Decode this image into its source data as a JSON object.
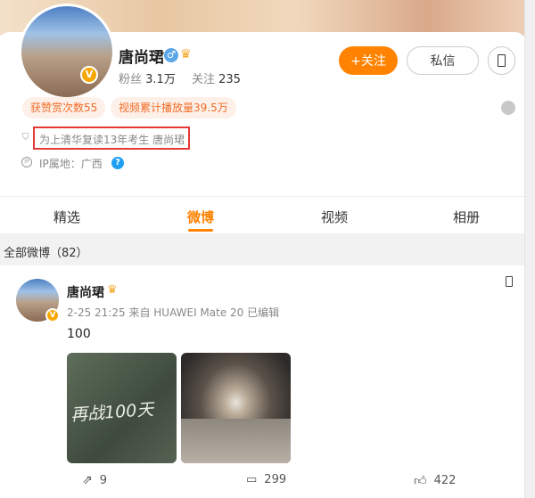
{
  "profile": {
    "name": "唐尚珺",
    "gender_icon": "male-icon",
    "fans_label": "粉丝",
    "fans": "3.1万",
    "follow_label": "关注",
    "follow": "235",
    "follow_button": "+关注",
    "message_button": "私信",
    "badges": [
      "获赞赏次数55",
      "视频累计播放量39.5万"
    ],
    "bio": "为上清华复读13年考生 唐尚珺",
    "ip": "IP属地：广西"
  },
  "tabs": [
    "精选",
    "微博",
    "视频",
    "相册"
  ],
  "active_tab": 1,
  "section_title": "全部微博（82）",
  "post": {
    "author": "唐尚珺",
    "meta": "2-25 21:25 来自 HUAWEI Mate 20 已编辑",
    "text": "100",
    "image1_text": "再战100天",
    "reposts": "9",
    "comments": "299",
    "likes": "422"
  },
  "colors": {
    "accent": "#ff8200",
    "badge_text": "#f26c26",
    "highlight_box": "#e53935"
  }
}
